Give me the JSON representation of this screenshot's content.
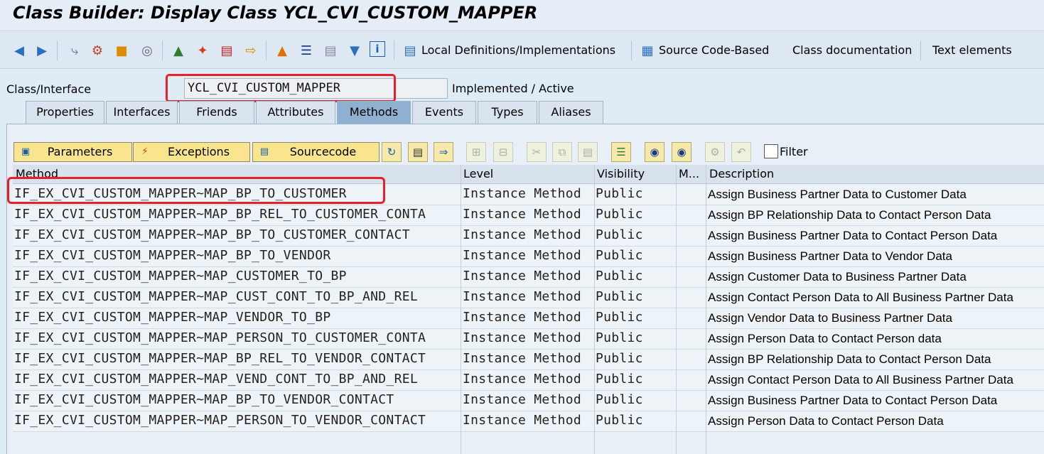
{
  "window": {
    "title": "Class Builder: Display Class YCL_CVI_CUSTOM_MAPPER"
  },
  "toolbar": {
    "icons": [
      "back-icon",
      "forward-icon",
      "other-object-icon",
      "display-change-icon",
      "activate-icon",
      "check-icon",
      "where-used-icon",
      "object-list-icon",
      "navigate-icon",
      "enhance-icon",
      "hierarchy-icon",
      "print-icon",
      "layout-icon",
      "filter-icon",
      "info-icon"
    ],
    "local_definitions_label": "Local Definitions/Implementations",
    "source_code_label": "Source Code-Based",
    "class_doc_label": "Class documentation",
    "text_elements_label": "Text elements"
  },
  "header": {
    "class_label": "Class/Interface",
    "class_value": "YCL_CVI_CUSTOM_MAPPER",
    "status": "Implemented / Active"
  },
  "tabs": [
    {
      "label": "Properties",
      "active": false
    },
    {
      "label": "Interfaces",
      "active": false
    },
    {
      "label": "Friends",
      "active": false
    },
    {
      "label": "Attributes",
      "active": false
    },
    {
      "label": "Methods",
      "active": true
    },
    {
      "label": "Events",
      "active": false
    },
    {
      "label": "Types",
      "active": false
    },
    {
      "label": "Aliases",
      "active": false
    }
  ],
  "method_toolbar": {
    "parameters_label": "Parameters",
    "exceptions_label": "Exceptions",
    "sourcecode_label": "Sourcecode",
    "filter_label": "Filter"
  },
  "columns": {
    "method": "Method",
    "level": "Level",
    "visibility": "Visibility",
    "modeled": "M...",
    "description": "Description"
  },
  "rows": [
    {
      "method": "IF_EX_CVI_CUSTOM_MAPPER~MAP_BP_TO_CUSTOMER",
      "level": "Instance Method",
      "visibility": "Public",
      "description": "Assign Business Partner Data to Customer Data"
    },
    {
      "method": "IF_EX_CVI_CUSTOM_MAPPER~MAP_BP_REL_TO_CUSTOMER_CONTA",
      "level": "Instance Method",
      "visibility": "Public",
      "description": "Assign BP Relationship Data to Contact Person Data"
    },
    {
      "method": "IF_EX_CVI_CUSTOM_MAPPER~MAP_BP_TO_CUSTOMER_CONTACT",
      "level": "Instance Method",
      "visibility": "Public",
      "description": "Assign Business Partner Data to Contact Person Data"
    },
    {
      "method": "IF_EX_CVI_CUSTOM_MAPPER~MAP_BP_TO_VENDOR",
      "level": "Instance Method",
      "visibility": "Public",
      "description": "Assign Business Partner Data to Vendor Data"
    },
    {
      "method": "IF_EX_CVI_CUSTOM_MAPPER~MAP_CUSTOMER_TO_BP",
      "level": "Instance Method",
      "visibility": "Public",
      "description": "Assign Customer Data to Business Partner Data"
    },
    {
      "method": "IF_EX_CVI_CUSTOM_MAPPER~MAP_CUST_CONT_TO_BP_AND_REL",
      "level": "Instance Method",
      "visibility": "Public",
      "description": "Assign Contact Person Data to All Business Partner Data"
    },
    {
      "method": "IF_EX_CVI_CUSTOM_MAPPER~MAP_VENDOR_TO_BP",
      "level": "Instance Method",
      "visibility": "Public",
      "description": "Assign Vendor Data to Business Partner Data"
    },
    {
      "method": "IF_EX_CVI_CUSTOM_MAPPER~MAP_PERSON_TO_CUSTOMER_CONTA",
      "level": "Instance Method",
      "visibility": "Public",
      "description": "Assign Person Data to Contact Person data"
    },
    {
      "method": "IF_EX_CVI_CUSTOM_MAPPER~MAP_BP_REL_TO_VENDOR_CONTACT",
      "level": "Instance Method",
      "visibility": "Public",
      "description": "Assign BP Relationship Data to Contact Person Data"
    },
    {
      "method": "IF_EX_CVI_CUSTOM_MAPPER~MAP_VEND_CONT_TO_BP_AND_REL",
      "level": "Instance Method",
      "visibility": "Public",
      "description": "Assign Contact Person Data to All Business Partner Data"
    },
    {
      "method": "IF_EX_CVI_CUSTOM_MAPPER~MAP_BP_TO_VENDOR_CONTACT",
      "level": "Instance Method",
      "visibility": "Public",
      "description": "Assign Business Partner Data to Contact Person Data"
    },
    {
      "method": "IF_EX_CVI_CUSTOM_MAPPER~MAP_PERSON_TO_VENDOR_CONTACT",
      "level": "Instance Method",
      "visibility": "Public",
      "description": "Assign Person Data to Contact Person Data"
    }
  ],
  "colors": {
    "highlight": "#e8202a",
    "button": "#f9e58e",
    "active_tab": "#8fb0d0"
  }
}
